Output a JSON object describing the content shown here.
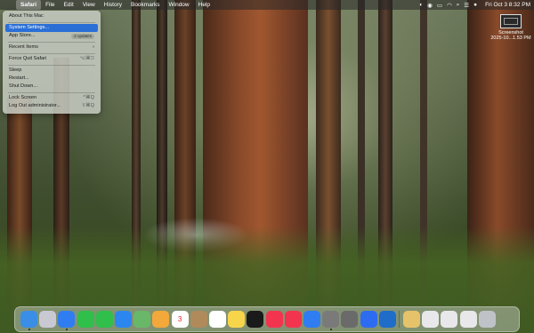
{
  "menubar": {
    "apple_glyph": "",
    "items": [
      {
        "label": "Safari",
        "bold": true
      },
      {
        "label": "File"
      },
      {
        "label": "Edit"
      },
      {
        "label": "View"
      },
      {
        "label": "History"
      },
      {
        "label": "Bookmarks"
      },
      {
        "label": "Window"
      },
      {
        "label": "Help"
      }
    ],
    "status_icons": [
      "control-icon",
      "record-icon",
      "battery-icon",
      "wifi-icon",
      "search-icon",
      "control-center-icon",
      "siri-icon"
    ],
    "clock": "Fri Oct 3  8:32 PM"
  },
  "apple_menu": {
    "items": [
      {
        "label": "About This Mac"
      },
      {
        "label": "System Settings...",
        "selected": true
      },
      {
        "label": "App Store...",
        "badge": "2 updates"
      },
      {
        "label": "Recent Items"
      },
      {
        "label": "Force Quit Safari",
        "shortcut": "⌥⌘⎋"
      },
      {
        "label": "Sleep"
      },
      {
        "label": "Restart..."
      },
      {
        "label": "Shut Down..."
      },
      {
        "label": "Lock Screen",
        "shortcut": "^⌘Q"
      },
      {
        "label": "Log Out administrator...",
        "shortcut": "⇧⌘Q"
      }
    ]
  },
  "desktop_icon": {
    "name": "Screenshot",
    "date": "2025-10...1.53 PM"
  },
  "dock": {
    "apps": [
      {
        "name": "finder",
        "color": "#3a8ee6"
      },
      {
        "name": "launchpad",
        "color": "#c9c9d4"
      },
      {
        "name": "safari",
        "color": "#2f7df0"
      },
      {
        "name": "facetime",
        "color": "#2fbf4a"
      },
      {
        "name": "messages",
        "color": "#2fbf4a"
      },
      {
        "name": "mail",
        "color": "#2b86f0"
      },
      {
        "name": "maps",
        "color": "#69b86a"
      },
      {
        "name": "photos",
        "color": "#f2a83a"
      },
      {
        "name": "calendar",
        "color": "#ffffff",
        "text": "3"
      },
      {
        "name": "contacts",
        "color": "#b08a5b"
      },
      {
        "name": "reminders",
        "color": "#ffffff"
      },
      {
        "name": "notes",
        "color": "#f7d54a"
      },
      {
        "name": "apple-tv",
        "color": "#1a1a1a"
      },
      {
        "name": "music",
        "color": "#f3344e"
      },
      {
        "name": "news",
        "color": "#f3344e"
      },
      {
        "name": "app-store",
        "color": "#2f7df0"
      },
      {
        "name": "system-settings",
        "color": "#7a7a7a"
      },
      {
        "name": "printer",
        "color": "#6a6a6a"
      },
      {
        "name": "zoom",
        "color": "#2d6cf0"
      },
      {
        "name": "outlook",
        "color": "#1f6cc9"
      },
      {
        "name": "downloads-stack",
        "color": "#e6c36a"
      },
      {
        "name": "screenshot-stack-1",
        "color": "#e8e8ea"
      },
      {
        "name": "screenshot-stack-2",
        "color": "#e8e8ea"
      },
      {
        "name": "screenshot-stack-3",
        "color": "#e8e8ea"
      },
      {
        "name": "trash",
        "color": "#bfc3c7"
      }
    ]
  }
}
